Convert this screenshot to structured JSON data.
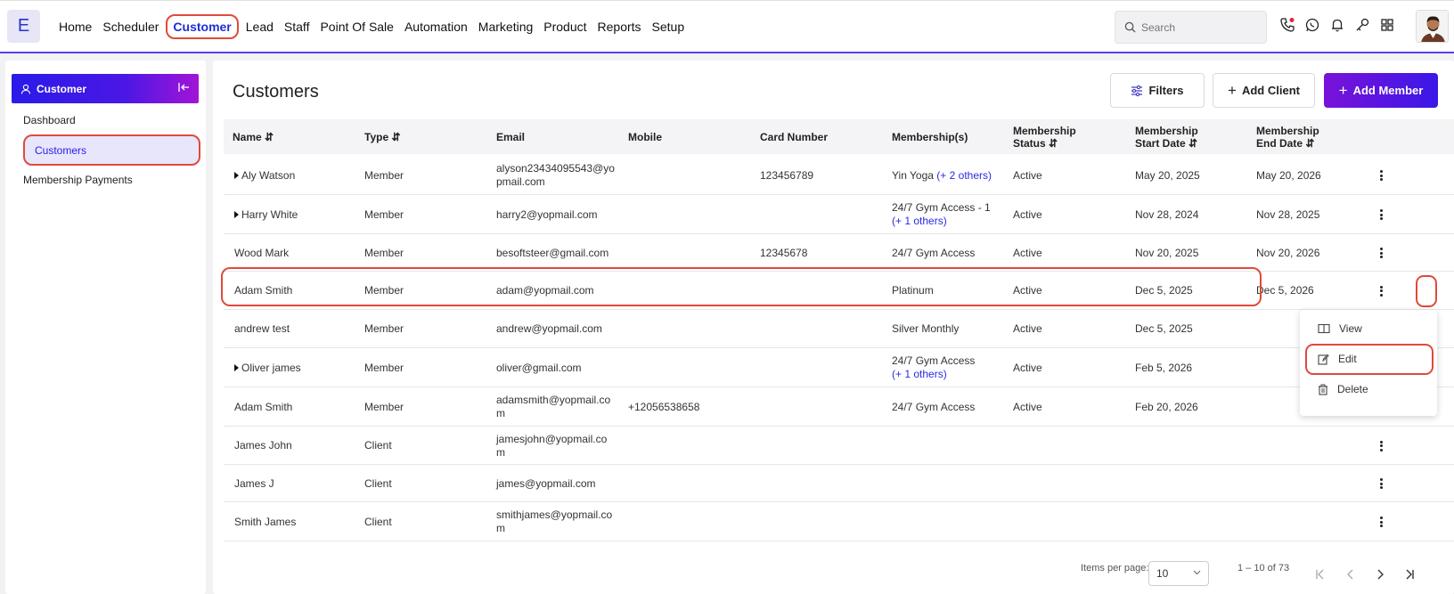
{
  "app": {
    "logo_letter": "E"
  },
  "nav": {
    "items": [
      "Home",
      "Scheduler",
      "Customer",
      "Lead",
      "Staff",
      "Point Of Sale",
      "Automation",
      "Marketing",
      "Product",
      "Reports",
      "Setup"
    ],
    "active": "Customer"
  },
  "search": {
    "placeholder": "Search"
  },
  "top_icons": [
    "phone-icon",
    "whatsapp-icon",
    "bell-icon",
    "key-icon",
    "apps-grid-icon"
  ],
  "sidebar": {
    "title": "Customer",
    "items": [
      "Dashboard",
      "Customers",
      "Membership Payments"
    ],
    "active": "Customers"
  },
  "main": {
    "title": "Customers",
    "buttons": {
      "filters": "Filters",
      "add_client": "Add Client",
      "add_member": "Add Member"
    }
  },
  "table": {
    "headers": {
      "name": "Name",
      "type": "Type",
      "email": "Email",
      "mobile": "Mobile",
      "card_number": "Card Number",
      "memberships": "Membership(s)",
      "status_1": "Membership",
      "status_2": "Status",
      "start_1": "Membership",
      "start_2": "Start Date",
      "end_1": "Membership",
      "end_2": "End Date"
    },
    "rows": [
      {
        "name": "Aly Watson",
        "expand": true,
        "type": "Member",
        "email_1": "alyson23434095543@yo",
        "email_2": "pmail.com",
        "mobile": "",
        "card": "123456789",
        "membership": "Yin Yoga",
        "membership_extra": "(+ 2 others)",
        "membership_2": "",
        "status": "Active",
        "start": "May 20, 2025",
        "end": "May 20, 2026"
      },
      {
        "name": "Harry White",
        "expand": true,
        "type": "Member",
        "email_1": "harry2@yopmail.com",
        "email_2": "",
        "mobile": "",
        "card": "",
        "membership": "24/7 Gym Access - 1",
        "membership_extra": "",
        "membership_2": "(+ 1 others)",
        "status": "Active",
        "start": "Nov 28, 2024",
        "end": "Nov 28, 2025"
      },
      {
        "name": "Wood Mark",
        "expand": false,
        "type": "Member",
        "email_1": "besoftsteer@gmail.com",
        "email_2": "",
        "mobile": "",
        "card": "12345678",
        "membership": "24/7 Gym Access",
        "membership_extra": "",
        "membership_2": "",
        "status": "Active",
        "start": "Nov 20, 2025",
        "end": "Nov 20, 2026"
      },
      {
        "name": "Adam Smith",
        "expand": false,
        "type": "Member",
        "email_1": "adam@yopmail.com",
        "email_2": "",
        "mobile": "",
        "card": "",
        "membership": "Platinum",
        "membership_extra": "",
        "membership_2": "",
        "status": "Active",
        "start": "Dec 5, 2025",
        "end": "Dec 5, 2026"
      },
      {
        "name": "andrew test",
        "expand": false,
        "type": "Member",
        "email_1": "andrew@yopmail.com",
        "email_2": "",
        "mobile": "",
        "card": "",
        "membership": "Silver Monthly",
        "membership_extra": "",
        "membership_2": "",
        "status": "Active",
        "start": "Dec 5, 2025",
        "end": ""
      },
      {
        "name": "Oliver james",
        "expand": true,
        "type": "Member",
        "email_1": "oliver@gmail.com",
        "email_2": "",
        "mobile": "",
        "card": "",
        "membership": "24/7 Gym Access",
        "membership_extra": "",
        "membership_2": "(+ 1 others)",
        "status": "Active",
        "start": "Feb 5, 2026",
        "end": ""
      },
      {
        "name": "Adam Smith",
        "expand": false,
        "type": "Member",
        "email_1": "adamsmith@yopmail.co",
        "email_2": "m",
        "mobile": "+12056538658",
        "card": "",
        "membership": "24/7 Gym Access",
        "membership_extra": "",
        "membership_2": "",
        "status": "Active",
        "start": "Feb 20, 2026",
        "end": ""
      },
      {
        "name": "James John",
        "expand": false,
        "type": "Client",
        "email_1": "jamesjohn@yopmail.co",
        "email_2": "m",
        "mobile": "",
        "card": "",
        "membership": "",
        "membership_extra": "",
        "membership_2": "",
        "status": "",
        "start": "",
        "end": ""
      },
      {
        "name": "James J",
        "expand": false,
        "type": "Client",
        "email_1": "james@yopmail.com",
        "email_2": "",
        "mobile": "",
        "card": "",
        "membership": "",
        "membership_extra": "",
        "membership_2": "",
        "status": "",
        "start": "",
        "end": ""
      },
      {
        "name": "Smith James",
        "expand": false,
        "type": "Client",
        "email_1": "smithjames@yopmail.co",
        "email_2": "m",
        "mobile": "",
        "card": "",
        "membership": "",
        "membership_extra": "",
        "membership_2": "",
        "status": "",
        "start": "",
        "end": ""
      }
    ]
  },
  "context_menu": {
    "view": "View",
    "edit": "Edit",
    "delete": "Delete"
  },
  "pagination": {
    "items_per_page_label": "Items per page:",
    "items_per_page": "10",
    "range": "1 – 10 of 73"
  },
  "colors": {
    "accent": "#2a1be8",
    "highlight": "#e04a3a",
    "link": "#2a2be0"
  }
}
